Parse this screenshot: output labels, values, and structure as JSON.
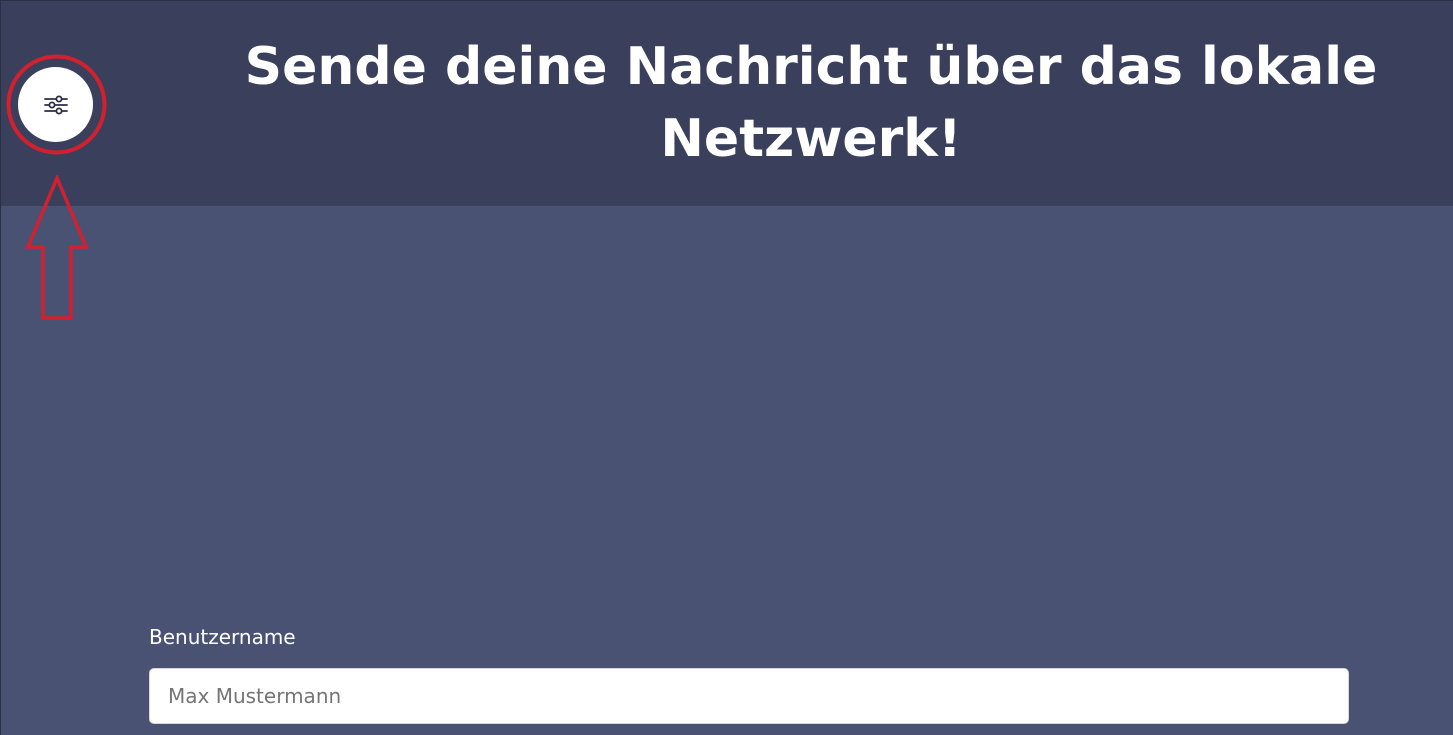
{
  "header": {
    "title": "Sende deine Nachricht über das lokale Netzwerk!",
    "settings_icon": "sliders-icon"
  },
  "annotation": {
    "highlight_color": "#d2202f"
  },
  "form": {
    "username_label": "Benutzername",
    "username_placeholder": "Max Mustermann",
    "username_value": ""
  },
  "colors": {
    "header_bg": "#3a405c",
    "page_bg": "#4a5274",
    "text": "#ffffff"
  }
}
